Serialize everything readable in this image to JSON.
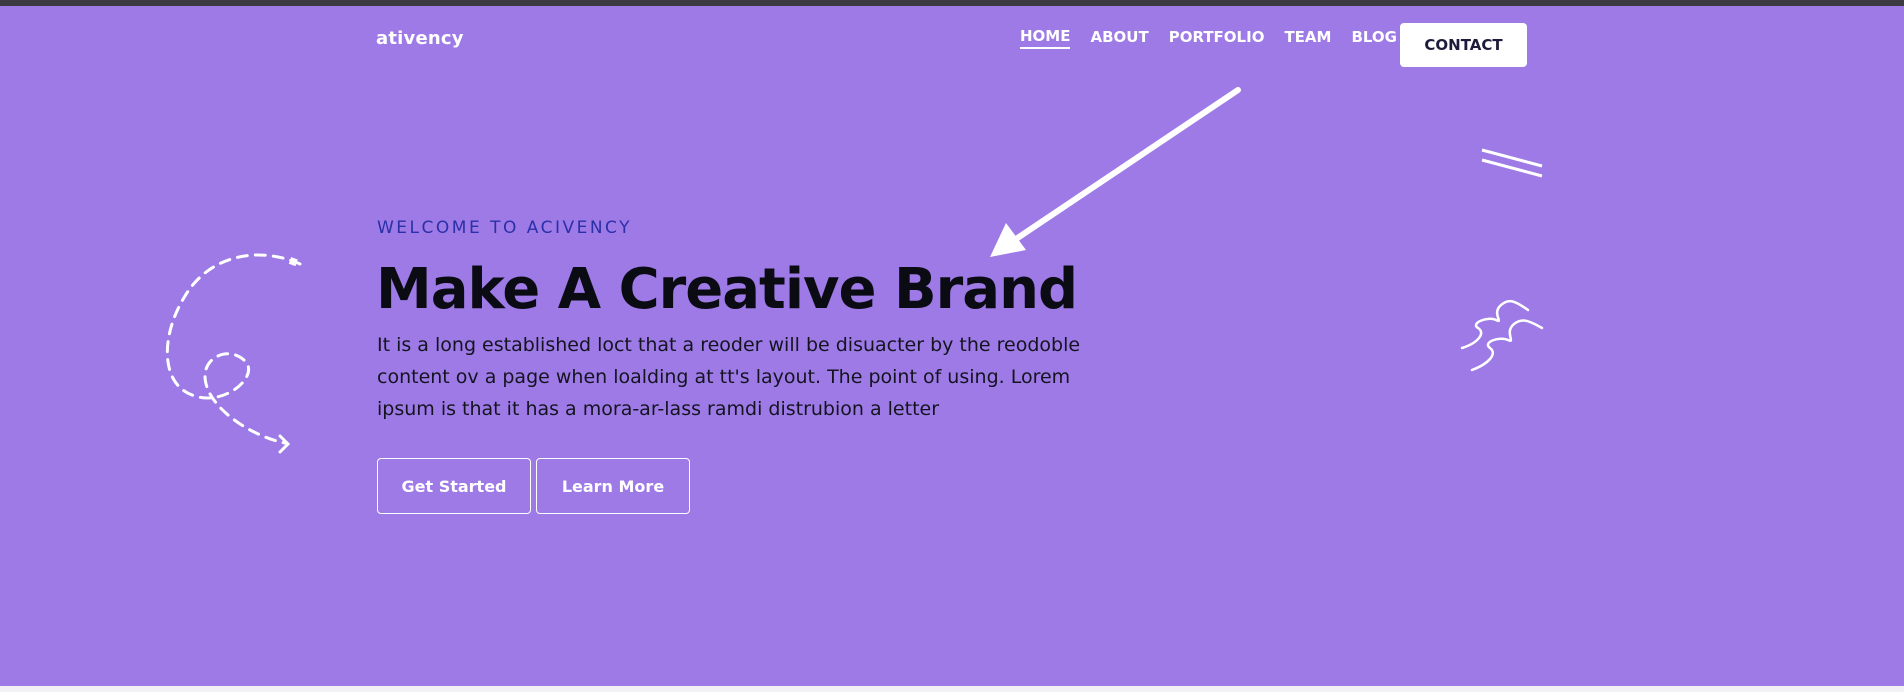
{
  "brand": {
    "name": "ativency"
  },
  "nav": {
    "items": [
      {
        "label": "HOME",
        "active": true
      },
      {
        "label": "ABOUT",
        "active": false
      },
      {
        "label": "PORTFOLIO",
        "active": false
      },
      {
        "label": "TEAM",
        "active": false
      },
      {
        "label": "BLOG",
        "active": false
      }
    ],
    "contact_label": "CONTACT"
  },
  "hero": {
    "eyebrow": "WELCOME TO ACIVENCY",
    "title": "Make A Creative Brand",
    "description": "It is a long established loct that a reoder will be disuacter by the reodoble content ov a page when loalding at tt's layout. The point of using. Lorem ipsum is that it has a mora-ar-lass ramdi distrubion a letter",
    "buttons": {
      "primary": "Get Started",
      "secondary": "Learn More"
    }
  },
  "colors": {
    "hero_background": "#9d7ae6",
    "eyebrow": "#2b30a8",
    "headline": "#0b0b14",
    "contact_button_bg": "#ffffff",
    "top_bar": "#3b3a40"
  },
  "decorations": {
    "icons": [
      "dashed-swirl-icon",
      "double-line-icon",
      "squiggle-icon",
      "annotation-arrow-icon"
    ]
  }
}
